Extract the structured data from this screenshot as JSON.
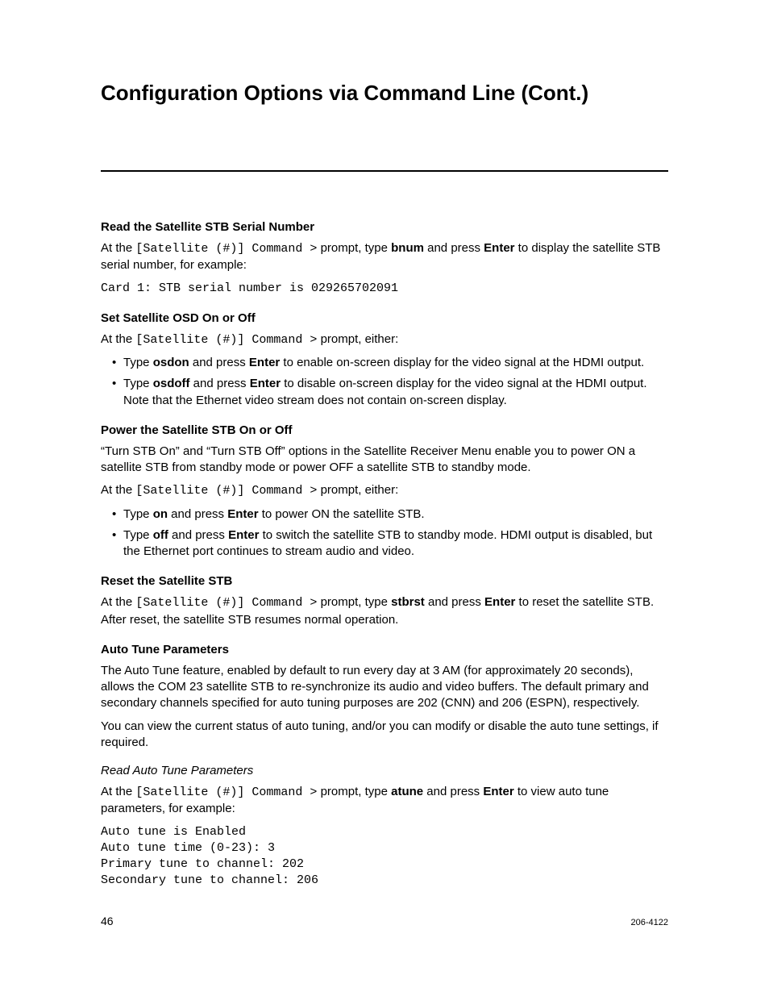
{
  "title": "Configuration Options via Command Line (Cont.)",
  "prompt_text": "[Satellite (#)] Command >",
  "sections": {
    "bnum": {
      "heading": "Read the Satellite STB Serial Number",
      "para_pre": "At the ",
      "para_mid1": " prompt, type ",
      "cmd": "bnum",
      "para_mid2": " and press ",
      "enter": "Enter",
      "para_post": " to display the satellite STB serial number, for example:",
      "output": "Card 1: STB serial number is 029265702091"
    },
    "osd": {
      "heading": "Set Satellite OSD On or Off",
      "para_pre": "At the ",
      "para_post": " prompt, either:",
      "items": [
        {
          "pre": "Type ",
          "cmd": "osdon",
          "mid": " and press ",
          "enter": "Enter",
          "post": " to enable on-screen display for the video signal at the HDMI output."
        },
        {
          "pre": "Type ",
          "cmd": "osdoff",
          "mid": " and press ",
          "enter": "Enter",
          "post": " to disable on-screen display for the video signal at the HDMI output. Note that the Ethernet video stream does not contain on-screen display."
        }
      ]
    },
    "power": {
      "heading": "Power the Satellite STB On or Off",
      "intro": "“Turn STB On” and “Turn STB Off” options in the Satellite Receiver Menu enable you to power ON a satellite STB from standby mode or power OFF a satellite STB to standby mode.",
      "para_pre": "At the ",
      "para_post": " prompt, either:",
      "items": [
        {
          "pre": "Type ",
          "cmd": "on",
          "mid": " and press ",
          "enter": "Enter",
          "post": " to power ON the satellite STB."
        },
        {
          "pre": "Type ",
          "cmd": "off",
          "mid": " and press ",
          "enter": "Enter",
          "post": " to switch the satellite STB to standby mode. HDMI output is disabled, but the Ethernet port continues to stream audio and video."
        }
      ]
    },
    "reset": {
      "heading": "Reset the Satellite STB",
      "para_pre": "At the ",
      "para_mid1": " prompt, type ",
      "cmd": "stbrst",
      "para_mid2": " and press ",
      "enter": "Enter",
      "para_post": " to reset the satellite STB. After reset, the satellite STB resumes normal operation."
    },
    "atune": {
      "heading": "Auto Tune Parameters",
      "intro1": "The Auto Tune feature, enabled by default to run every day at 3 AM (for approximately 20 seconds), allows the COM 23 satellite STB to re-synchronize its audio and video buffers. The default primary and secondary channels specified for auto tuning purposes are 202 (CNN) and 206 (ESPN), respectively.",
      "intro2": "You can view the current status of auto tuning, and/or you can modify or disable the auto tune settings, if required.",
      "subheading": "Read Auto Tune Parameters",
      "para_pre": "At the ",
      "para_mid1": " prompt, type ",
      "cmd": "atune",
      "para_mid2": " and press ",
      "enter": "Enter",
      "para_post": " to view auto tune parameters, for example:",
      "output": "Auto tune is Enabled\nAuto tune time (0-23): 3\nPrimary tune to channel: 202\nSecondary tune to channel: 206"
    }
  },
  "footer": {
    "page": "46",
    "docnum": "206-4122"
  }
}
